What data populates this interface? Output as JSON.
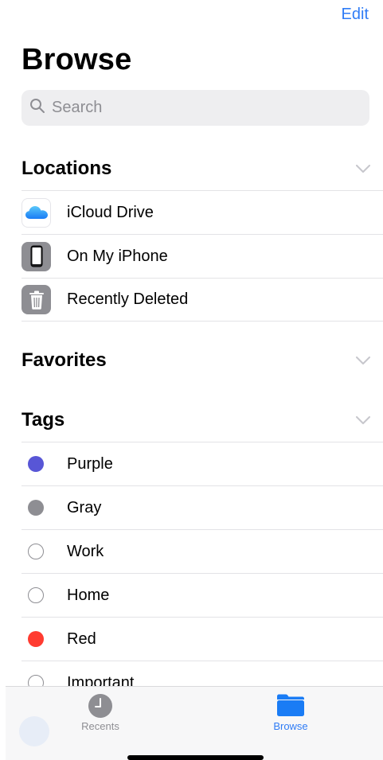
{
  "header": {
    "edit_label": "Edit",
    "title": "Browse"
  },
  "search": {
    "placeholder": "Search",
    "icon": "magnifier-icon"
  },
  "locations": {
    "title": "Locations",
    "items": [
      {
        "label": "iCloud Drive",
        "icon": "icloud-icon"
      },
      {
        "label": "On My iPhone",
        "icon": "iphone-icon"
      },
      {
        "label": "Recently Deleted",
        "icon": "trash-icon"
      }
    ]
  },
  "favorites": {
    "title": "Favorites"
  },
  "tags": {
    "title": "Tags",
    "items": [
      {
        "label": "Purple",
        "color": "#5856d6",
        "filled": true
      },
      {
        "label": "Gray",
        "color": "#8e8e93",
        "filled": true
      },
      {
        "label": "Work",
        "color": "#ffffff",
        "filled": false
      },
      {
        "label": "Home",
        "color": "#ffffff",
        "filled": false
      },
      {
        "label": "Red",
        "color": "#ff3b30",
        "filled": true
      },
      {
        "label": "Important",
        "color": "#ffffff",
        "filled": false
      }
    ]
  },
  "tab_bar": {
    "recents_label": "Recents",
    "browse_label": "Browse",
    "active": "Browse"
  },
  "colors": {
    "accent": "#2f7cf6",
    "separator": "#e3e3e6",
    "secondary_text": "#8e8e93"
  }
}
